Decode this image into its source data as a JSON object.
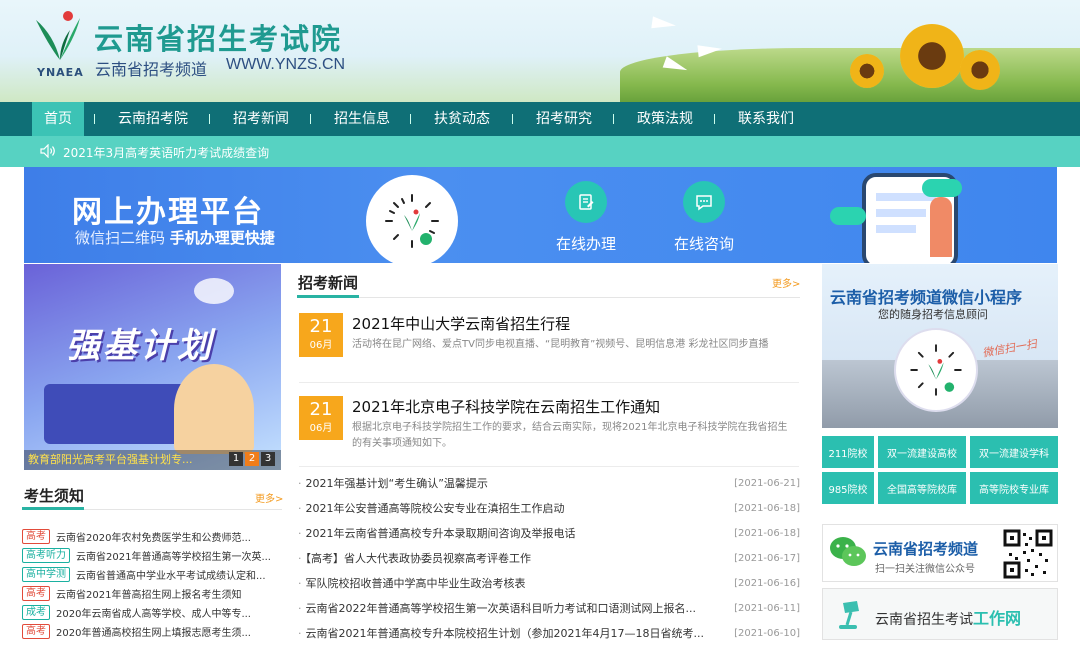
{
  "header": {
    "logo_abbr": "YNAEA",
    "site_title": "云南省招生考试院",
    "site_subtitle": "云南省招考频道",
    "site_url": "WWW.YNZS.CN"
  },
  "nav": {
    "items": [
      {
        "label": "首页",
        "active": true
      },
      {
        "label": "云南招考院",
        "active": false
      },
      {
        "label": "招考新闻",
        "active": false
      },
      {
        "label": "招生信息",
        "active": false
      },
      {
        "label": "扶贫动态",
        "active": false
      },
      {
        "label": "招考研究",
        "active": false
      },
      {
        "label": "政策法规",
        "active": false
      },
      {
        "label": "联系我们",
        "active": false
      }
    ]
  },
  "notice": {
    "text": "2021年3月高考英语听力考试成绩查询"
  },
  "banner": {
    "title": "网上办理平台",
    "subtitle_plain": "微信扫二维码",
    "subtitle_bold": "手机办理更快捷",
    "services": [
      {
        "label": "在线办理",
        "icon": "edit-doc-icon"
      },
      {
        "label": "在线咨询",
        "icon": "chat-bubble-icon"
      }
    ]
  },
  "promo": {
    "title": "强基计划",
    "caption": "教育部阳光高考平台强基计划专...",
    "pages": [
      "1",
      "2",
      "3"
    ],
    "active_page": "2"
  },
  "notes": {
    "heading": "考生须知",
    "more": "更多>",
    "items": [
      {
        "tag": "高考",
        "tag_color": "red",
        "text": "云南省2020年农村免费医学生和公费师范..."
      },
      {
        "tag": "高考听力",
        "tag_color": "teal",
        "text": "云南省2021年普通高等学校招生第一次英..."
      },
      {
        "tag": "高中学测",
        "tag_color": "teal",
        "text": "云南省普通高中学业水平考试成绩认定和..."
      },
      {
        "tag": "高考",
        "tag_color": "red",
        "text": "云南省2021年普高招生网上报名考生须知"
      },
      {
        "tag": "成考",
        "tag_color": "teal",
        "text": "2020年云南省成人高等学校、成人中等专..."
      },
      {
        "tag": "高考",
        "tag_color": "red",
        "text": "2020年普通高校招生网上填报志愿考生须..."
      }
    ]
  },
  "news": {
    "heading": "招考新闻",
    "more": "更多>",
    "featured": [
      {
        "day": "21",
        "month": "06月",
        "title": "2021年中山大学云南省招生行程",
        "desc": "活动将在昆广网络、爱点TV同步电视直播、“昆明教育”视频号、昆明信息港 彩龙社区同步直播"
      },
      {
        "day": "21",
        "month": "06月",
        "title": "2021年北京电子科技学院在云南招生工作通知",
        "desc": "根据北京电子科技学院招生工作的要求，结合云南实际，现将2021年北京电子科技学院在我省招生的有关事项通知如下。"
      }
    ],
    "list": [
      {
        "title": "2021年强基计划“考生确认”温馨提示",
        "date": "[2021-06-21]"
      },
      {
        "title": "2021年公安普通高等院校公安专业在滇招生工作启动",
        "date": "[2021-06-18]"
      },
      {
        "title": "2021年云南省普通高校专升本录取期间咨询及举报电话",
        "date": "[2021-06-18]"
      },
      {
        "title": "【高考】省人大代表政协委员视察高考评卷工作",
        "date": "[2021-06-17]"
      },
      {
        "title": "军队院校招收普通中学高中毕业生政治考核表",
        "date": "[2021-06-16]"
      },
      {
        "title": "云南省2022年普通高等学校招生第一次英语科目听力考试和口语测试网上报名...",
        "date": "[2021-06-11]"
      },
      {
        "title": "云南省2021年普通高校专升本院校招生计划（参加2021年4月17—18日省统考...",
        "date": "[2021-06-10]"
      }
    ]
  },
  "mini_program": {
    "title": "云南省招考频道微信小程序",
    "subtitle": "您的随身招考信息顾问",
    "scan_text": "微信扫一扫"
  },
  "quick_links": [
    [
      "211院校",
      "双一流建设高校",
      "双一流建设学科"
    ],
    [
      "985院校",
      "全国高等院校库",
      "高等院校专业库"
    ]
  ],
  "wechat_card": {
    "title": "云南省招考频道",
    "subtitle": "扫一扫关注微信公众号"
  },
  "work_card": {
    "prefix": "云南省招生考试",
    "highlight": "工作网"
  },
  "colors": {
    "nav_bg": "#0f6f76",
    "nav_active": "#3cc3b5",
    "notice_bg": "#57d2c2",
    "accent_teal": "#2bbfb0",
    "date_orange": "#f7a71c",
    "banner_blue": "#4b8ff0"
  }
}
